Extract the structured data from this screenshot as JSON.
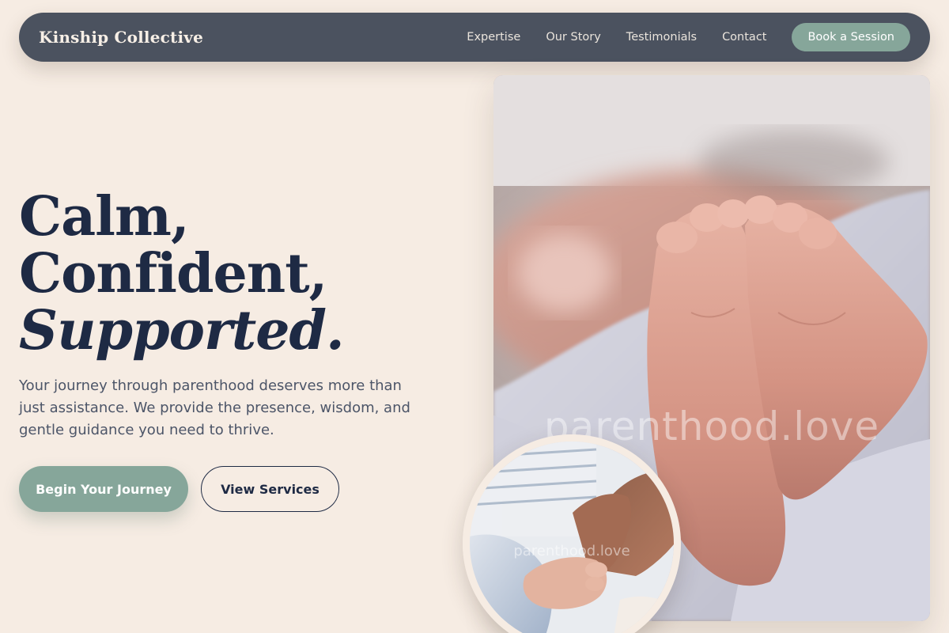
{
  "nav": {
    "brand": "Kinship Collective",
    "links": [
      "Expertise",
      "Our Story",
      "Testimonials",
      "Contact"
    ],
    "cta": "Book a Session"
  },
  "hero": {
    "title_line1": "Calm,",
    "title_line2": "Confident,",
    "title_line3": "Supported.",
    "subtitle": "Your journey through parenthood deserves more than just assistance. We provide the presence, wisdom, and gentle guidance you need to thrive.",
    "primary_button": "Begin Your Journey",
    "secondary_button": "View Services"
  },
  "images": {
    "main_watermark": "parenthood.love",
    "small_watermark": "parenthood.love"
  },
  "colors": {
    "background": "#f6ece3",
    "navbar": "#4b525f",
    "accent_sage": "#86a69a",
    "heading_navy": "#1e2a44"
  }
}
